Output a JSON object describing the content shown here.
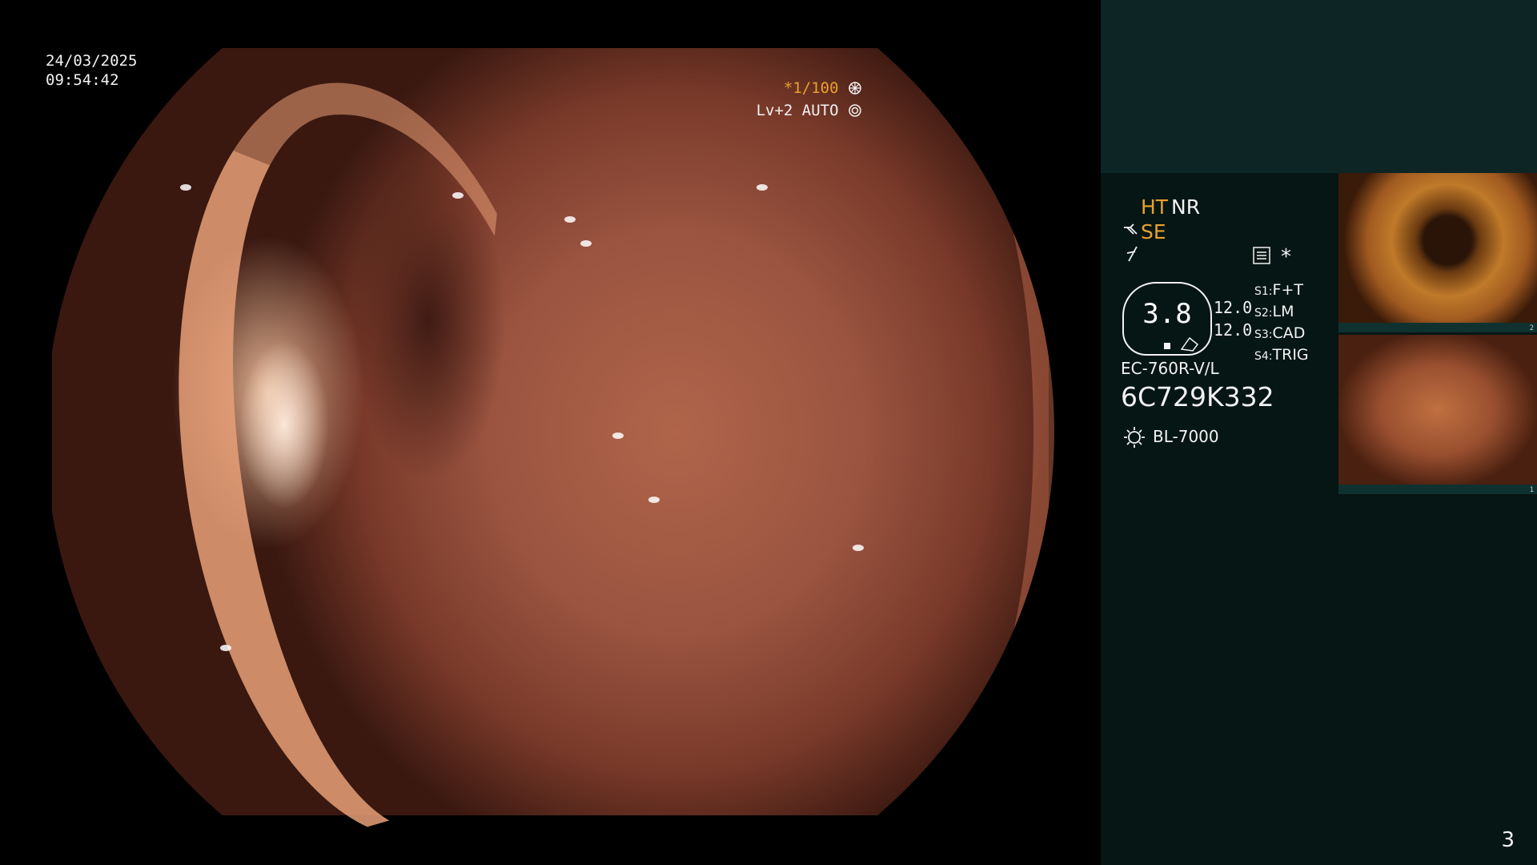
{
  "overlay": {
    "date": "24/03/2025",
    "time": "09:54:42",
    "shutter": "*1/100",
    "level": "Lv+2 AUTO"
  },
  "panel": {
    "enhance_ht": "HT",
    "enhance_nr": "NR",
    "enhance_se": "SE",
    "gauge_value": "3.8",
    "readout_1": "12.0",
    "readout_2": "12.0",
    "switches": [
      {
        "key": "S1",
        "value": "F+T"
      },
      {
        "key": "S2",
        "value": "LM"
      },
      {
        "key": "S3",
        "value": "CAD"
      },
      {
        "key": "S4",
        "value": "TRIG"
      }
    ],
    "scope_model": "EC-760R-V/L",
    "serial": "6C729K332",
    "light_source": "BL-7000",
    "asterisk": "*"
  },
  "thumbnails": [
    {
      "number": "2"
    },
    {
      "number": "1"
    }
  ],
  "page_number": "3",
  "colors": {
    "accent_orange": "#e7a12e",
    "panel_bg": "#061614",
    "panel_top_bg": "#0d2525"
  }
}
